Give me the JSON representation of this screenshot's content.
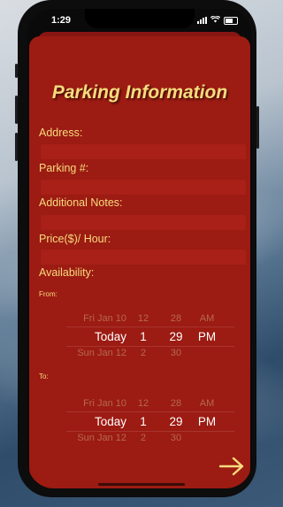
{
  "status_bar": {
    "time": "1:29"
  },
  "form": {
    "title": "Parking Information",
    "address": {
      "label": "Address:",
      "value": ""
    },
    "parking_number": {
      "label": "Parking #:",
      "value": ""
    },
    "notes": {
      "label": "Additional Notes:",
      "value": ""
    },
    "price": {
      "label": "Price($)/ Hour:",
      "value": ""
    },
    "availability_label": "Availability:"
  },
  "from_picker": {
    "label": "From:",
    "above": {
      "date": "Fri Jan 10",
      "hour": "12",
      "minute": "28",
      "ampm": "AM"
    },
    "selected": {
      "date": "Today",
      "hour": "1",
      "minute": "29",
      "ampm": "PM"
    },
    "below": {
      "date": "Sun Jan 12",
      "hour": "2",
      "minute": "30",
      "ampm": ""
    }
  },
  "to_picker": {
    "label": "To:",
    "above": {
      "date": "Fri Jan 10",
      "hour": "12",
      "minute": "28",
      "ampm": "AM"
    },
    "selected": {
      "date": "Today",
      "hour": "1",
      "minute": "29",
      "ampm": "PM"
    },
    "below": {
      "date": "Sun Jan 12",
      "hour": "2",
      "minute": "30",
      "ampm": ""
    }
  },
  "colors": {
    "sheet": "#9c1b12",
    "accent": "#f7dc7e"
  },
  "icons": {
    "next": "arrow-right-icon"
  }
}
